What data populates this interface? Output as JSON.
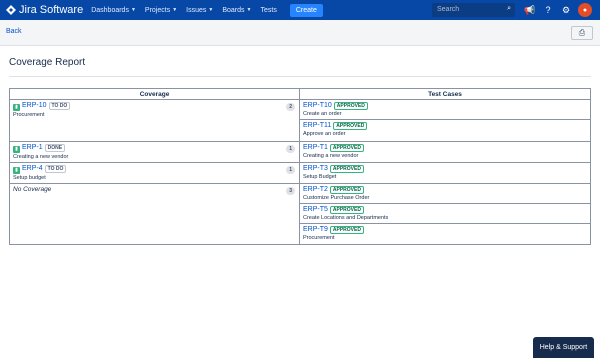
{
  "nav": {
    "logo": "Jira Software",
    "items": [
      {
        "label": "Dashboards",
        "caret": true
      },
      {
        "label": "Projects",
        "caret": true
      },
      {
        "label": "Issues",
        "caret": true
      },
      {
        "label": "Boards",
        "caret": true
      },
      {
        "label": "Tests",
        "caret": false
      }
    ],
    "create": "Create",
    "search_placeholder": "Search"
  },
  "subbar": {
    "back": "Back"
  },
  "page": {
    "title": "Coverage Report"
  },
  "table": {
    "headers": [
      "Coverage",
      "Test Cases"
    ],
    "rows": [
      {
        "key": "ERP-10",
        "status": "TO DO",
        "summary": "Procurement",
        "count": "2",
        "tests": [
          {
            "key": "ERP-T10",
            "status": "APPROVED",
            "summary": "Create an order"
          },
          {
            "key": "ERP-T11",
            "status": "APPROVED",
            "summary": "Approve an order"
          }
        ]
      },
      {
        "key": "ERP-1",
        "status": "DONE",
        "summary": "Creating a new vendor",
        "count": "1",
        "tests": [
          {
            "key": "ERP-T1",
            "status": "APPROVED",
            "summary": "Creating a new vendor"
          }
        ]
      },
      {
        "key": "ERP-4",
        "status": "TO DO",
        "summary": "Setup budget",
        "count": "1",
        "tests": [
          {
            "key": "ERP-T3",
            "status": "APPROVED",
            "summary": "Setup Budget"
          }
        ]
      },
      {
        "nocoverage": "No Coverage",
        "count": "3",
        "tests": [
          {
            "key": "ERP-T2",
            "status": "APPROVED",
            "summary": "Customize Purchase Order"
          },
          {
            "key": "ERP-T5",
            "status": "APPROVED",
            "summary": "Create Locations and Departments"
          },
          {
            "key": "ERP-T9",
            "status": "APPROVED",
            "summary": "Procurement"
          }
        ]
      }
    ]
  },
  "help": "Help & Support",
  "colors": {
    "nav": "#0747a6",
    "link": "#0052cc",
    "approved": "#36b37e",
    "avatar": "#e34d28"
  }
}
